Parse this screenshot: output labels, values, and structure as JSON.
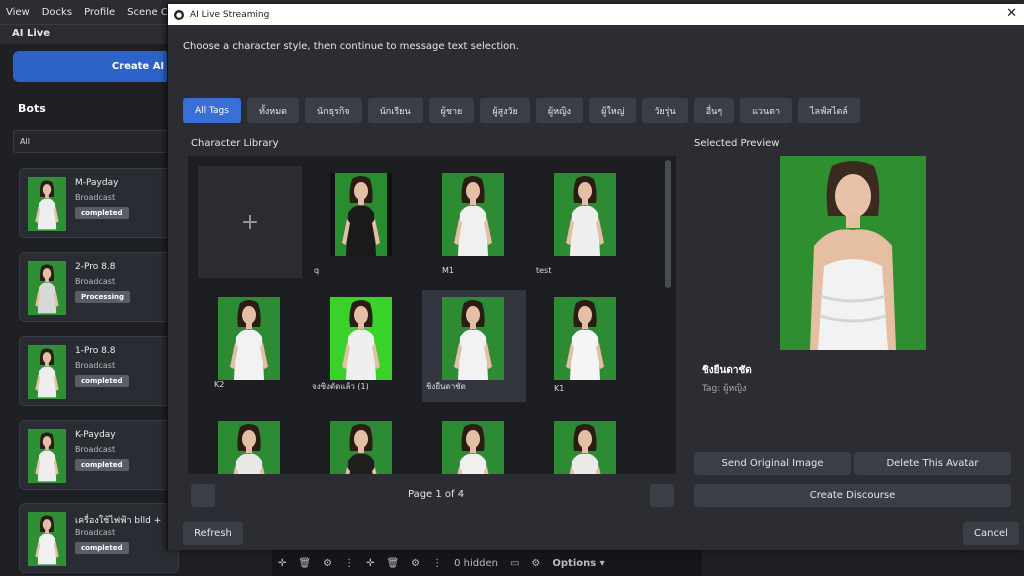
{
  "menu": [
    "View",
    "Docks",
    "Profile",
    "Scene Colle"
  ],
  "dock_title": "AI Live",
  "create_ai_label": "Create AI",
  "bots_title": "Bots",
  "filter_value": "All",
  "bots": [
    {
      "name": "M-Payday",
      "type": "Broadcast",
      "status": "completed"
    },
    {
      "name": "2-Pro 8.8",
      "type": "Broadcast",
      "status": "Processing"
    },
    {
      "name": "1-Pro 8.8",
      "type": "Broadcast",
      "status": "completed"
    },
    {
      "name": "K-Payday",
      "type": "Broadcast",
      "status": "completed"
    },
    {
      "name": "เครื่องใช้ไฟฟ้า blld +",
      "type": "Broadcast",
      "status": "completed"
    }
  ],
  "bottom_toolbar": {
    "hidden_label": "0 hidden",
    "options_label": "Options ▾"
  },
  "dialog": {
    "title": "AI Live Streaming",
    "instruction": "Choose a character style, then continue to message text selection.",
    "tags": [
      "All Tags",
      "ทั้งหมด",
      "นักธุรกิจ",
      "นักเรียน",
      "ผู้ชาย",
      "ผู้สูงวัย",
      "ผู้หญิง",
      "ผู้ใหญ่",
      "วัยรุ่น",
      "อื่นๆ",
      "แวนตา",
      "ไลฟ์สไตล์"
    ],
    "active_tag": 0,
    "library_label": "Character Library",
    "preview_label": "Selected Preview",
    "tiles": [
      {
        "label": "",
        "add": true
      },
      {
        "label": "q"
      },
      {
        "label": "M1"
      },
      {
        "label": "test"
      },
      {
        "label": "K2"
      },
      {
        "label": "จงซิงตัดแล้ว (1)"
      },
      {
        "label": "ชิงยืนดาชัด",
        "selected": true
      },
      {
        "label": "K1"
      },
      {
        "label": ""
      },
      {
        "label": ""
      },
      {
        "label": ""
      },
      {
        "label": ""
      }
    ],
    "add_symbol": "+",
    "page_text": "Page 1 of 4",
    "preview_name": "ชิงยืนดาชัด",
    "preview_tag": "Tag: ผู้หญิง",
    "send_original_label": "Send Original Image",
    "delete_avatar_label": "Delete This Avatar",
    "create_discourse_label": "Create Discourse",
    "refresh_label": "Refresh",
    "cancel_label": "Cancel",
    "close_symbol": "✕"
  },
  "colors": {
    "accent": "#3a6fd8",
    "create_button": "#2d63c8",
    "green_screen": "#2d8b33",
    "dialog_bg": "#2b2d33"
  }
}
